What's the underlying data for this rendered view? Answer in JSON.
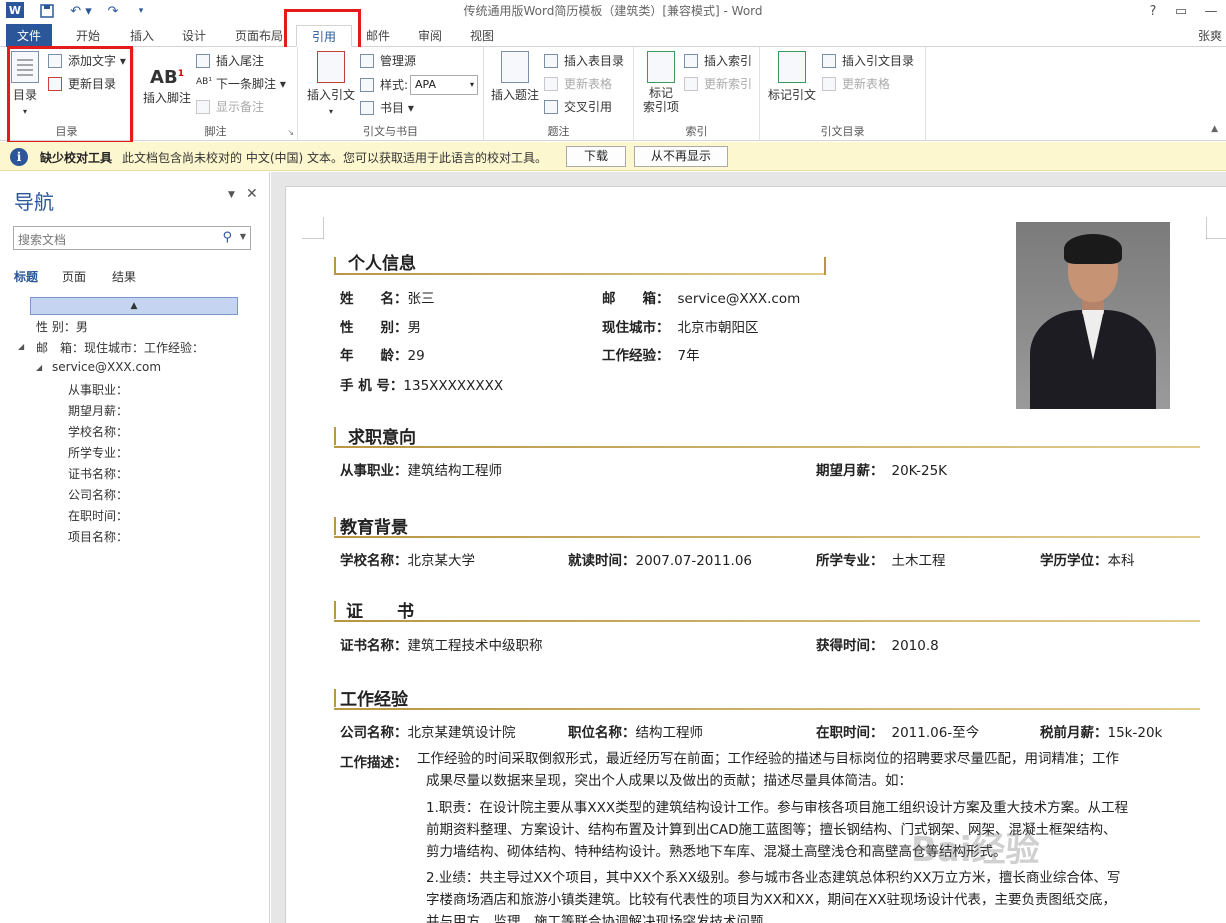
{
  "window": {
    "title": "传统通用版Word简历模板（建筑类）[兼容模式] - Word",
    "help": "?",
    "user": "张爽"
  },
  "tabs": [
    {
      "label": "文件"
    },
    {
      "label": "开始"
    },
    {
      "label": "插入"
    },
    {
      "label": "设计"
    },
    {
      "label": "页面布局"
    },
    {
      "label": "引用"
    },
    {
      "label": "邮件"
    },
    {
      "label": "审阅"
    },
    {
      "label": "视图"
    }
  ],
  "ribbon": {
    "toc": {
      "big": "目录",
      "add_text": "添加文字",
      "update": "更新目录",
      "label": "目录"
    },
    "footnote": {
      "insert_footnote": "插入脚注",
      "insert_endnote": "插入尾注",
      "next_footnote": "下一条脚注",
      "show_notes": "显示备注",
      "label": "脚注"
    },
    "citation": {
      "insert_citation": "插入引文",
      "manage_sources": "管理源",
      "style_label": "样式:",
      "style_value": "APA",
      "bibliography": "书目",
      "label": "引文与书目"
    },
    "caption": {
      "insert_caption": "插入题注",
      "insert_table_figures": "插入表目录",
      "update_table": "更新表格",
      "cross_reference": "交叉引用",
      "label": "题注"
    },
    "index": {
      "mark_entry": "标记\n索引项",
      "insert_index": "插入索引",
      "update_index": "更新索引",
      "label": "索引"
    },
    "toa": {
      "mark_citation": "标记引文",
      "insert_toa": "插入引文目录",
      "update_table": "更新表格",
      "label": "引文目录"
    }
  },
  "infobar": {
    "title": "缺少校对工具",
    "message": "此文档包含尚未校对的 中文(中国) 文本。您可以获取适用于此语言的校对工具。",
    "download": "下载",
    "dont_show": "从不再显示"
  },
  "nav": {
    "title": "导航",
    "search_placeholder": "搜索文档",
    "tabs": [
      "标题",
      "页面",
      "结果"
    ],
    "items": [
      "性 别：男",
      "邮　箱：现住城市：工作经验：",
      "service@XXX.com",
      "从事职业：",
      "期望月薪：",
      "学校名称：",
      "所学专业：",
      "证书名称：",
      "公司名称：",
      "在职时间：",
      "项目名称："
    ]
  },
  "resume": {
    "personal": {
      "title": "个人信息",
      "name_label": "姓　　名：",
      "name": "张三",
      "email_label": "邮　　箱：",
      "email": "service@XXX.com",
      "gender_label": "性　　别：",
      "gender": "男",
      "city_label": "现住城市：",
      "city": "北京市朝阳区",
      "age_label": "年　　龄：",
      "age": "29",
      "exp_label": "工作经验：",
      "exp": "7年",
      "phone_label": "手 机 号：",
      "phone": "135XXXXXXXX"
    },
    "intent": {
      "title": "求职意向",
      "job_label": "从事职业：",
      "job": "建筑结构工程师",
      "salary_label": "期望月薪：",
      "salary": "20K-25K"
    },
    "education": {
      "title": "教育背景",
      "school_label": "学校名称：",
      "school": "北京某大学",
      "period_label": "就读时间：",
      "period": "2007.07-2011.06",
      "major_label": "所学专业：",
      "major": "土木工程",
      "degree_label": "学历学位：",
      "degree": "本科"
    },
    "cert": {
      "title": "证　　书",
      "name_label": "证书名称：",
      "name": "建筑工程技术中级职称",
      "date_label": "获得时间：",
      "date": "2010.8"
    },
    "work": {
      "title": "工作经验",
      "company_label": "公司名称：",
      "company": "北京某建筑设计院",
      "position_label": "职位名称：",
      "position": "结构工程师",
      "tenure_label": "在职时间：",
      "tenure": "2011.06-至今",
      "pay_label": "税前月薪：",
      "pay": "15k-20k",
      "desc_label": "工作描述：",
      "desc_line1": "工作经验的时间采取倒叙形式，最近经历写在前面；工作经验的描述与目标岗位的招聘要求尽量匹配，用词精准；工作",
      "desc_line2": "成果尽量以数据来呈现，突出个人成果以及做出的贡献；描述尽量具体简洁。如：",
      "duty_line1": "1.职责：在设计院主要从事XXX类型的建筑结构设计工作。参与审核各项目施工组织设计方案及重大技术方案。从工程",
      "duty_line2": "前期资料整理、方案设计、结构布置及计算到出CAD施工蓝图等；擅长钢结构、门式钢架、网架、混凝土框架结构、",
      "duty_line3": "剪力墙结构、砌体结构、特种结构设计。熟悉地下车库、混凝土高壁浅仓和高壁高仓等结构形式。",
      "perf_line1": "2.业绩：共主导过XX个项目，其中XX个系XX级别。参与城市各业态建筑总体积约XX万立方米，擅长商业综合体、写",
      "perf_line2": "字楼商场酒店和旅游小镇类建筑。比较有代表性的项目为XX和XX，期间在XX驻现场设计代表，主要负责图纸交底，",
      "perf_line3": "并与甲方、监理、施工等联合协调解决现场突发技术问题。"
    }
  },
  "watermark": "Bai经验"
}
